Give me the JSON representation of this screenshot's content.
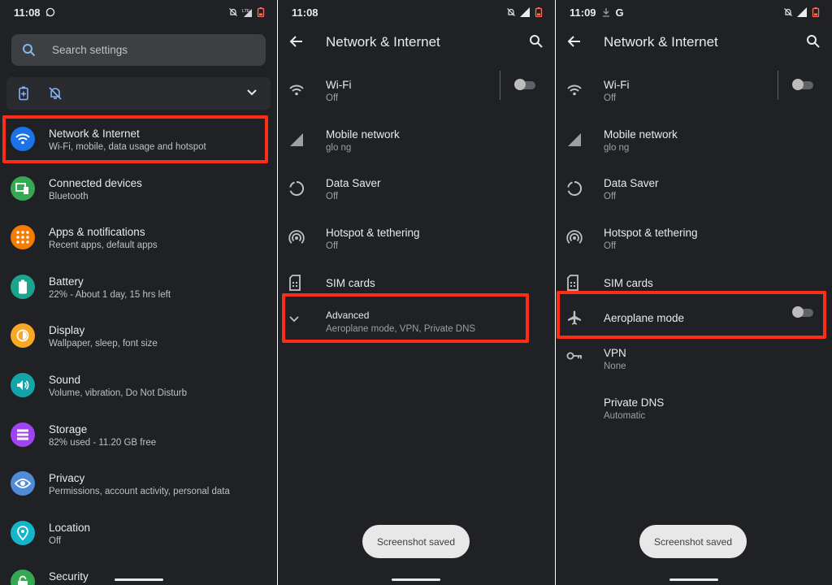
{
  "screen1": {
    "status": {
      "time": "11:08",
      "left_icons": [
        "whatsapp-icon"
      ],
      "right_icons": [
        "mute-icon",
        "lte-signal-icon",
        "battery-icon"
      ]
    },
    "search": {
      "placeholder": "Search settings"
    },
    "quick_icons": [
      "battery-saver-icon",
      "mute-icon",
      "chevron-down-icon"
    ],
    "items": [
      {
        "title": "Network & Internet",
        "subtitle": "Wi-Fi, mobile, data usage and hotspot",
        "icon": "wifi-icon",
        "color": "#1a73e8"
      },
      {
        "title": "Connected devices",
        "subtitle": "Bluetooth",
        "icon": "devices-icon",
        "color": "#34a853"
      },
      {
        "title": "Apps & notifications",
        "subtitle": "Recent apps, default apps",
        "icon": "apps-icon",
        "color": "#f57c00"
      },
      {
        "title": "Battery",
        "subtitle": "22% - About 1 day, 15 hrs left",
        "icon": "battery-icon",
        "color": "#1aa48d"
      },
      {
        "title": "Display",
        "subtitle": "Wallpaper, sleep, font size",
        "icon": "brightness-icon",
        "color": "#f9a825"
      },
      {
        "title": "Sound",
        "subtitle": "Volume, vibration, Do Not Disturb",
        "icon": "volume-icon",
        "color": "#12a4a8"
      },
      {
        "title": "Storage",
        "subtitle": "82% used - 11.20 GB free",
        "icon": "storage-icon",
        "color": "#a142f4"
      },
      {
        "title": "Privacy",
        "subtitle": "Permissions, account activity, personal data",
        "icon": "privacy-icon",
        "color": "#4f8bd6"
      },
      {
        "title": "Location",
        "subtitle": "Off",
        "icon": "location-icon",
        "color": "#12b5cb"
      },
      {
        "title": "Security",
        "subtitle": "",
        "icon": "lock-icon",
        "color": "#34a853"
      }
    ]
  },
  "screen2": {
    "status": {
      "time": "11:08",
      "right_icons": [
        "mute-icon",
        "no-sim-signal-icon",
        "battery-icon"
      ]
    },
    "appbar": {
      "title": "Network & Internet"
    },
    "rows": [
      {
        "title": "Wi-Fi",
        "subtitle": "Off",
        "icon": "wifi-icon",
        "toggle": "off"
      },
      {
        "title": "Mobile network",
        "subtitle": "glo ng",
        "icon": "signal-icon"
      },
      {
        "title": "Data Saver",
        "subtitle": "Off",
        "icon": "data-saver-icon"
      },
      {
        "title": "Hotspot & tethering",
        "subtitle": "Off",
        "icon": "hotspot-icon"
      },
      {
        "title": "SIM cards",
        "subtitle": "",
        "icon": "sim-card-icon"
      },
      {
        "title": "Advanced",
        "subtitle": "Aeroplane mode, VPN, Private DNS",
        "icon": "chevron-down-icon"
      }
    ],
    "toast": "Screenshot saved"
  },
  "screen3": {
    "status": {
      "time": "11:09",
      "left_icons": [
        "download-icon",
        "google-icon"
      ],
      "right_icons": [
        "mute-icon",
        "no-sim-signal-icon",
        "battery-icon"
      ]
    },
    "appbar": {
      "title": "Network & Internet"
    },
    "rows": [
      {
        "title": "Wi-Fi",
        "subtitle": "Off",
        "icon": "wifi-icon",
        "toggle": "off"
      },
      {
        "title": "Mobile network",
        "subtitle": "glo ng",
        "icon": "signal-icon"
      },
      {
        "title": "Data Saver",
        "subtitle": "Off",
        "icon": "data-saver-icon"
      },
      {
        "title": "Hotspot & tethering",
        "subtitle": "Off",
        "icon": "hotspot-icon"
      },
      {
        "title": "SIM cards",
        "subtitle": "",
        "icon": "sim-card-icon"
      },
      {
        "title": "Aeroplane mode",
        "subtitle": "",
        "icon": "airplane-icon",
        "toggle": "off"
      },
      {
        "title": "VPN",
        "subtitle": "None",
        "icon": "vpn-key-icon"
      },
      {
        "title": "Private DNS",
        "subtitle": "Automatic",
        "icon": ""
      }
    ],
    "toast": "Screenshot saved"
  },
  "colors": {
    "background": "#202124",
    "highlight": "#ff2d16",
    "text": "#e8eaed",
    "subtext": "#bdc1c6"
  }
}
